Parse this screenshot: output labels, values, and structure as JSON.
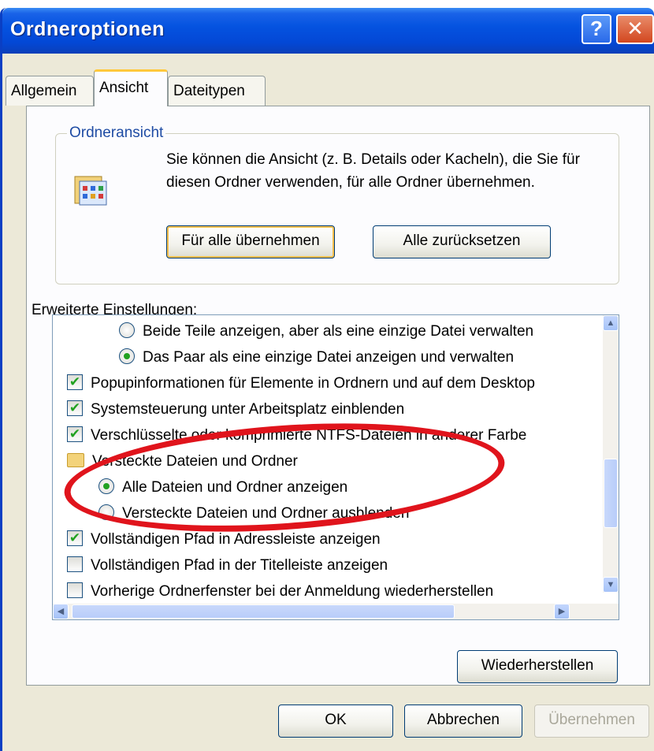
{
  "window": {
    "title": "Ordneroptionen",
    "help_glyph": "?",
    "close_glyph": "✕"
  },
  "tabs": [
    {
      "label": "Allgemein"
    },
    {
      "label": "Ansicht"
    },
    {
      "label": "Dateitypen"
    }
  ],
  "folder_view": {
    "legend": "Ordneransicht",
    "description": "Sie können die Ansicht (z. B. Details oder Kacheln), die Sie für diesen Ordner verwenden, für alle Ordner übernehmen.",
    "apply_all_label": "Für alle übernehmen",
    "reset_all_label": "Alle zurücksetzen"
  },
  "advanced": {
    "label": "Erweiterte Einstellungen:",
    "items": [
      {
        "type": "radio",
        "checked": false,
        "label": "Beide Teile anzeigen, aber als eine einzige Datei verwalten"
      },
      {
        "type": "radio",
        "checked": true,
        "label": "Das Paar als eine einzige Datei anzeigen und verwalten"
      },
      {
        "type": "checkbox",
        "checked": true,
        "label": "Popupinformationen für Elemente in Ordnern und auf dem Desktop"
      },
      {
        "type": "checkbox",
        "checked": true,
        "label": "Systemsteuerung unter Arbeitsplatz einblenden"
      },
      {
        "type": "checkbox",
        "checked": true,
        "label": "Verschlüsselte oder komprimierte NTFS-Dateien in anderer Farbe"
      },
      {
        "type": "folder",
        "checked": false,
        "label": "Versteckte Dateien und Ordner"
      },
      {
        "type": "radio",
        "checked": true,
        "label": "Alle Dateien und Ordner anzeigen"
      },
      {
        "type": "radio",
        "checked": false,
        "label": "Versteckte Dateien und Ordner ausblenden"
      },
      {
        "type": "checkbox",
        "checked": true,
        "label": "Vollständigen Pfad in Adressleiste anzeigen"
      },
      {
        "type": "checkbox",
        "checked": false,
        "label": "Vollständigen Pfad in der Titelleiste anzeigen"
      },
      {
        "type": "checkbox",
        "checked": false,
        "label": "Vorherige Ordnerfenster bei der Anmeldung wiederherstellen"
      }
    ],
    "restore_label": "Wiederherstellen"
  },
  "footer": {
    "ok_label": "OK",
    "cancel_label": "Abbrechen",
    "apply_label": "Übernehmen"
  },
  "colors": {
    "titlebar": "#0553e0",
    "highlight_ellipse": "#e0141c",
    "check_green": "#21a121"
  }
}
